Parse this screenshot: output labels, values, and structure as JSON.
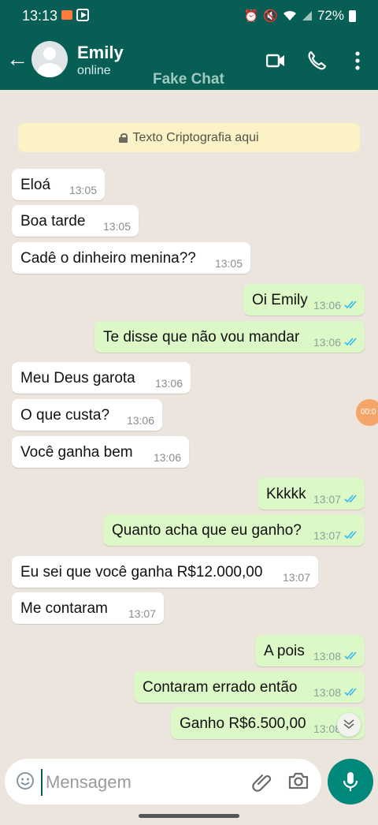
{
  "status_bar": {
    "time": "13:13",
    "battery": "72%"
  },
  "contact": {
    "name": "Emily",
    "status": "online"
  },
  "watermark": "Fake Chat",
  "encryption_notice": "Texto Criptografia aqui",
  "messages": [
    {
      "direction": "in",
      "text": "Eloá",
      "time": "13:05"
    },
    {
      "direction": "in",
      "text": "Boa tarde",
      "time": "13:05"
    },
    {
      "direction": "in",
      "text": "Cadê o dinheiro menina??",
      "time": "13:05"
    },
    {
      "direction": "out",
      "text": "Oi Emily",
      "time": "13:06",
      "read": true
    },
    {
      "direction": "out",
      "text": "Te disse que não vou mandar",
      "time": "13:06",
      "read": true
    },
    {
      "direction": "in",
      "text": "Meu Deus garota",
      "time": "13:06"
    },
    {
      "direction": "in",
      "text": "O que custa?",
      "time": "13:06"
    },
    {
      "direction": "in",
      "text": "Você ganha bem",
      "time": "13:06"
    },
    {
      "direction": "out",
      "text": "Kkkkk",
      "time": "13:07",
      "read": true
    },
    {
      "direction": "out",
      "text": "Quanto acha que eu ganho?",
      "time": "13:07",
      "read": true
    },
    {
      "direction": "in",
      "text": "Eu sei que você ganha R$12.000,00",
      "time": "13:07"
    },
    {
      "direction": "in",
      "text": "Me contaram",
      "time": "13:07"
    },
    {
      "direction": "out",
      "text": "A pois",
      "time": "13:08",
      "read": true
    },
    {
      "direction": "out",
      "text": "Contaram errado então",
      "time": "13:08",
      "read": true
    },
    {
      "direction": "out",
      "text": "Ganho R$6.500,00",
      "time": "13:08",
      "read": true
    }
  ],
  "recording_indicator": "00:0",
  "composer": {
    "placeholder": "Mensagem"
  },
  "colors": {
    "header": "#075e54",
    "incoming": "#ffffff",
    "outgoing": "#dcf8c6",
    "tick_read": "#34b7f1",
    "mic_button": "#00897b"
  },
  "icons": [
    "back-arrow-icon",
    "avatar",
    "video-call-icon",
    "phone-call-icon",
    "more-options-icon",
    "lock-icon",
    "double-check-icon",
    "scroll-down-icon",
    "emoji-icon",
    "attach-icon",
    "camera-icon",
    "mic-icon"
  ]
}
